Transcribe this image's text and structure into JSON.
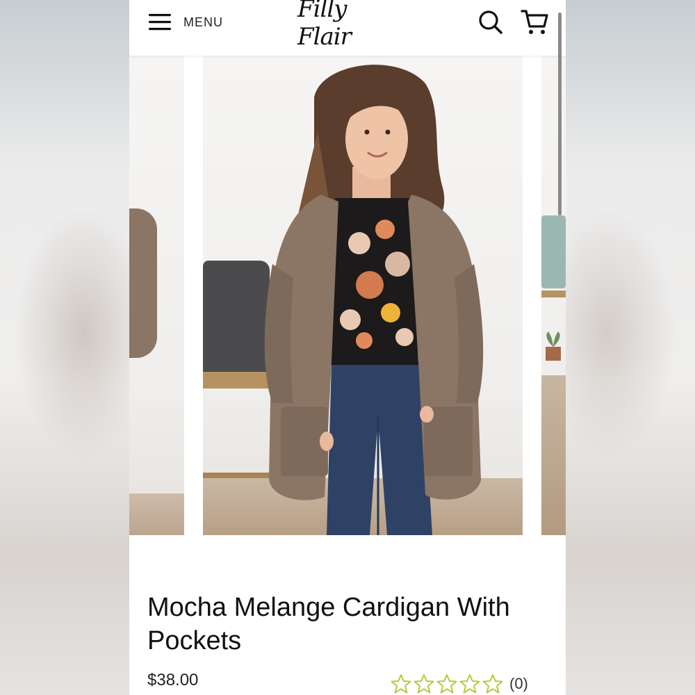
{
  "header": {
    "menu_label": "MENU",
    "logo_text": "Filly Flair",
    "icons": [
      "hamburger-icon",
      "search-icon",
      "cart-icon"
    ]
  },
  "carousel": {
    "slides": [
      "product-image-prev",
      "product-image-main",
      "product-image-next"
    ]
  },
  "product": {
    "title": "Mocha Melange Cardigan With Pockets",
    "price": "$38.00",
    "rating": {
      "stars": 0,
      "max_stars": 5,
      "review_count": "(0)"
    }
  },
  "colors": {
    "star_outline": "#b8c93a",
    "cardigan": "#8b7565",
    "text": "#111111"
  }
}
